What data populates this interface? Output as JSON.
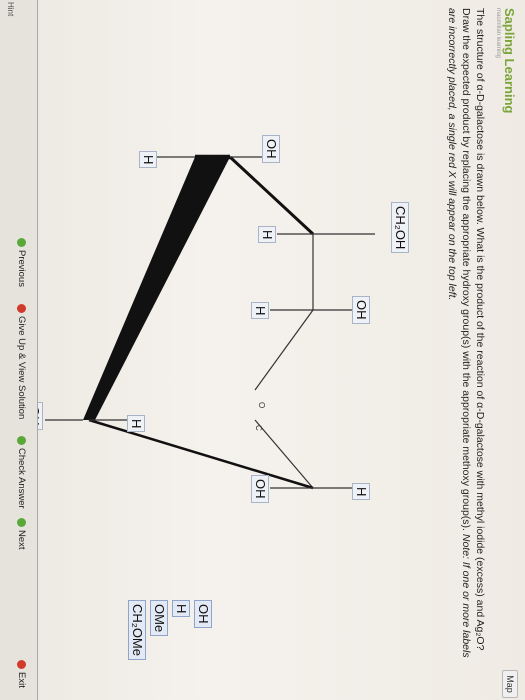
{
  "header": {
    "brand": "Sapling Learning",
    "brand_sub": "macmillan learning",
    "map_button": "Map"
  },
  "question": {
    "text": "The structure of α-D-galactose is drawn below. What is the product of the reaction of α-D-galactose with methyl iodide (excess) and Ag₂O? Draw the expected product by replacing the appropriate hydroxy group(s) with the appropriate methoxy group(s).",
    "note": "Note: If one or more labels are incorrectly placed, a single red X will appear on the top left."
  },
  "structure": {
    "ring_oxygen": "O",
    "anomeric_carbon": "C",
    "labels": {
      "ch2oh": "CH₂OH",
      "c4_oh": "OH",
      "c4_h": "H",
      "c5_h": "H",
      "c3_oh": "OH",
      "c3_h": "H",
      "c2_h": "H",
      "c2_oh": "OH",
      "c1_h": "H",
      "c1_oh": "OH"
    }
  },
  "palette": {
    "items": [
      "OH",
      "H",
      "OMe",
      "CH₂OMe"
    ]
  },
  "navigation": {
    "previous": "Previous",
    "give_up": "Give Up & View Solution",
    "check_answer": "Check Answer",
    "next": "Next",
    "exit": "Exit",
    "hint": "Hint"
  },
  "colors": {
    "brand": "#7aa53a",
    "label_box_bg": "#eef1f6",
    "palette_bg": "#e4eaf5",
    "nav_green": "#5aa83a",
    "nav_red": "#d23b2b"
  }
}
